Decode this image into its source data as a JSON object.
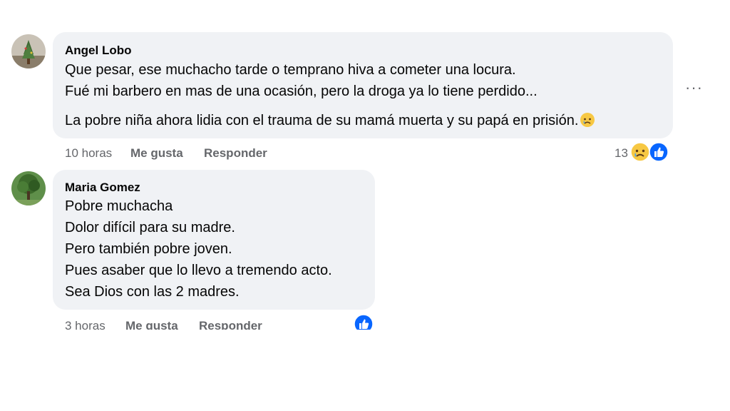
{
  "comments": [
    {
      "author": "Angel Lobo",
      "lines": [
        "Que pesar, ese muchacho tarde o temprano hiva a cometer una locura.",
        "Fué mi barbero en mas de una ocasión, pero la droga ya lo tiene perdido...",
        "La pobre niña ahora lidia con el trauma de su mamá muerta y su papá en prisión."
      ],
      "time": "10 horas",
      "like_label": "Me gusta",
      "reply_label": "Responder",
      "reaction_count": "13",
      "reactions": [
        "sad-emoji",
        "like-icon"
      ]
    },
    {
      "author": "Maria Gomez",
      "lines": [
        "Pobre muchacha",
        "Dolor difícil para su madre.",
        "Pero también pobre joven.",
        "Pues asaber que lo llevo a tremendo acto.",
        "Sea Dios con las 2 madres."
      ],
      "time": "3 horas",
      "like_label": "Me gusta",
      "reply_label": "Responder",
      "reactions": [
        "like-icon"
      ]
    }
  ],
  "more_label": "···",
  "colors": {
    "bubble": "#f0f2f5",
    "meta": "#65676b",
    "like_blue": "#0866ff"
  }
}
